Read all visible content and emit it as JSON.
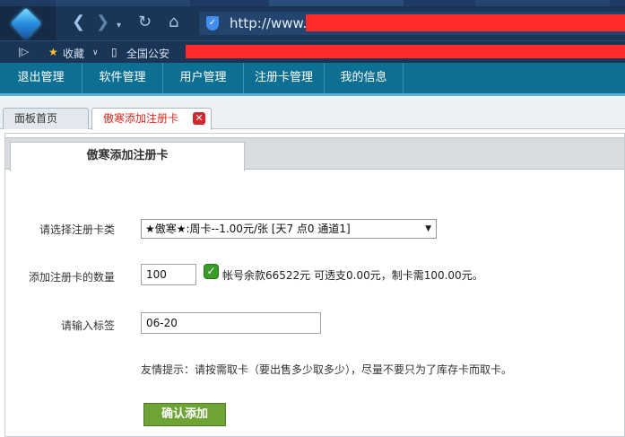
{
  "browser": {
    "url_prefix": "http://www.",
    "bookmarks": {
      "favorites_label": "收藏",
      "folder_label": "全国公安"
    }
  },
  "site_nav": {
    "items": [
      "退出管理",
      "软件管理",
      "用户管理",
      "注册卡管理",
      "我的信息"
    ]
  },
  "tabs": {
    "home": "面板首页",
    "active": "傲寒添加注册卡",
    "close_icon": "✕"
  },
  "panel": {
    "title": "傲寒添加注册卡"
  },
  "form": {
    "card_type_label": "请选择注册卡类",
    "card_type_value": "★傲寒★:周卡--1.00元/张 [天7 点0 通道1]",
    "quantity_label": "添加注册卡的数量",
    "quantity_value": "100",
    "balance_text": "帐号余款66522元 可透支0.00元，制卡需100.00元。",
    "tag_label": "请输入标签",
    "tag_value": "06-20",
    "hint": "友情提示：请按需取卡（要出售多少取多少），尽量不要只为了库存卡而取卡。",
    "submit_label": "确认添加"
  },
  "colors": {
    "nav_bg": "#0d6f93",
    "tab_active_text": "#e0271e",
    "submit_bg": "#6ea335",
    "redaction": "#ff2b2b"
  }
}
